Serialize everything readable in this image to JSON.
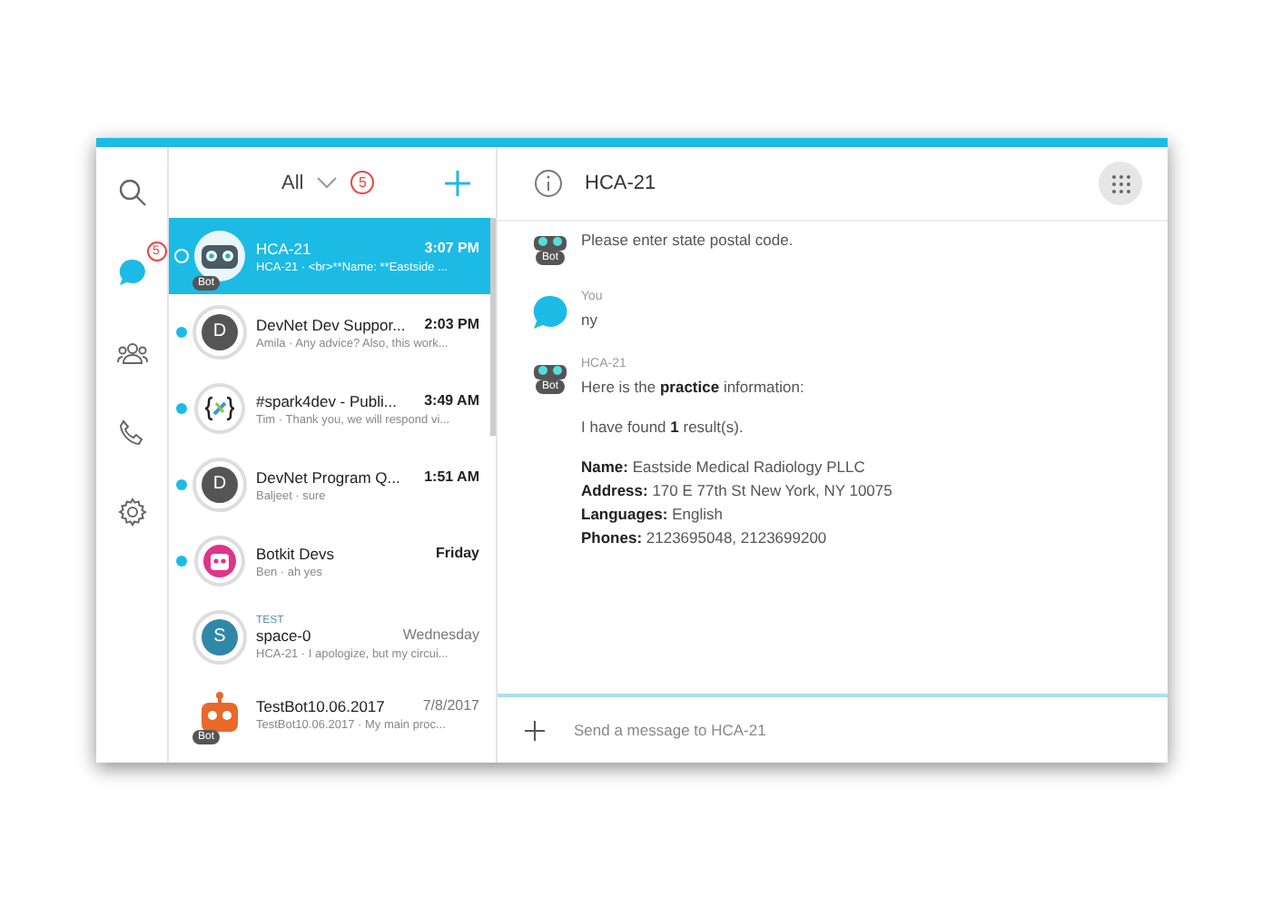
{
  "rail": {
    "items": [
      {
        "kind": "search"
      },
      {
        "kind": "messages",
        "badge": "5"
      },
      {
        "kind": "teams"
      },
      {
        "kind": "calls"
      },
      {
        "kind": "settings"
      }
    ]
  },
  "list_header": {
    "filter": "All",
    "count": "5"
  },
  "conversations": [
    {
      "title": "HCA-21",
      "time": "3:07 PM",
      "preview": "HCA-21 · <br>**Name: **Eastside ...",
      "kind": "bot",
      "bot_badge": "Bot",
      "unread": false,
      "selected": true
    },
    {
      "title": "DevNet Dev Suppor...",
      "time": "2:03 PM",
      "preview": "Amila · Any advice? Also, this work...",
      "kind": "letter",
      "letter": "D",
      "unread": true,
      "selected": false
    },
    {
      "title": "#spark4dev - Publi...",
      "time": "3:49 AM",
      "preview": "Tim · Thank you, we will respond vi...",
      "kind": "code",
      "unread": true,
      "selected": false
    },
    {
      "title": "DevNet Program Q...",
      "time": "1:51 AM",
      "preview": "Baljeet · sure",
      "kind": "letter",
      "letter": "D",
      "unread": true,
      "selected": false
    },
    {
      "title": "Botkit Devs",
      "time": "Friday",
      "preview": "Ben · ah yes",
      "kind": "botkit",
      "unread": true,
      "selected": false
    },
    {
      "title": "space-0",
      "time": "Wednesday",
      "preview": "HCA-21 · I apologize, but my circui...",
      "kind": "letter",
      "letter": "S",
      "color": "#2f88a8",
      "tag": "TEST",
      "unread": false,
      "selected": false
    },
    {
      "title": "TestBot10.06.2017",
      "time": "7/8/2017",
      "preview": "TestBot10.06.2017 · My main proc...",
      "kind": "orange-bot",
      "bot_badge": "Bot",
      "unread": false,
      "selected": false
    }
  ],
  "chat": {
    "title": "HCA-21",
    "messages": [
      {
        "kind": "bot",
        "badge": "Bot",
        "lines": [
          "Please enter state postal code."
        ]
      },
      {
        "kind": "you",
        "sender": "You",
        "lines": [
          "ny"
        ]
      },
      {
        "kind": "bot",
        "sender": "HCA-21",
        "badge": "Bot",
        "lines": [
          "Here is the **practice** information:",
          "I have found **1** result(s).",
          "**Name:** Eastside Medical Radiology PLLC",
          "**Address:** 170 E 77th St New York, NY 10075",
          "**Languages:** English",
          "**Phones:** 2123695048, 2123699200"
        ]
      }
    ],
    "composer": {
      "placeholder": "Send a message to HCA-21"
    }
  }
}
